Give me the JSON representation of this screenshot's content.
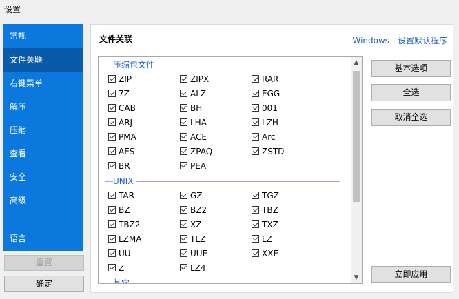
{
  "window": {
    "title": "设置"
  },
  "sidebar": {
    "items": [
      "常规",
      "文件关联",
      "右键菜单",
      "解压",
      "压缩",
      "查看",
      "安全",
      "高级",
      "语言"
    ]
  },
  "footer": {
    "reset_label": "重置",
    "ok_label": "确定"
  },
  "panel": {
    "title": "文件关联",
    "link": "Windows - 设置默认程序"
  },
  "actions": {
    "basic": "基本选项",
    "select_all": "全选",
    "deselect_all": "取消全选",
    "apply": "立即应用"
  },
  "groups": [
    {
      "title": "压缩包文件",
      "items": [
        "ZIP",
        "ZIPX",
        "RAR",
        "7Z",
        "ALZ",
        "EGG",
        "CAB",
        "BH",
        "001",
        "ARJ",
        "LHA",
        "LZH",
        "PMA",
        "ACE",
        "Arc",
        "AES",
        "ZPAQ",
        "ZSTD",
        "BR",
        "PEA"
      ]
    },
    {
      "title": "UNIX",
      "items": [
        "TAR",
        "GZ",
        "TGZ",
        "BZ",
        "BZ2",
        "TBZ",
        "TBZ2",
        "XZ",
        "TXZ",
        "LZMA",
        "TLZ",
        "LZ",
        "UU",
        "UUE",
        "XXE",
        "Z",
        "LZ4"
      ]
    },
    {
      "title": "其它",
      "items": []
    }
  ]
}
